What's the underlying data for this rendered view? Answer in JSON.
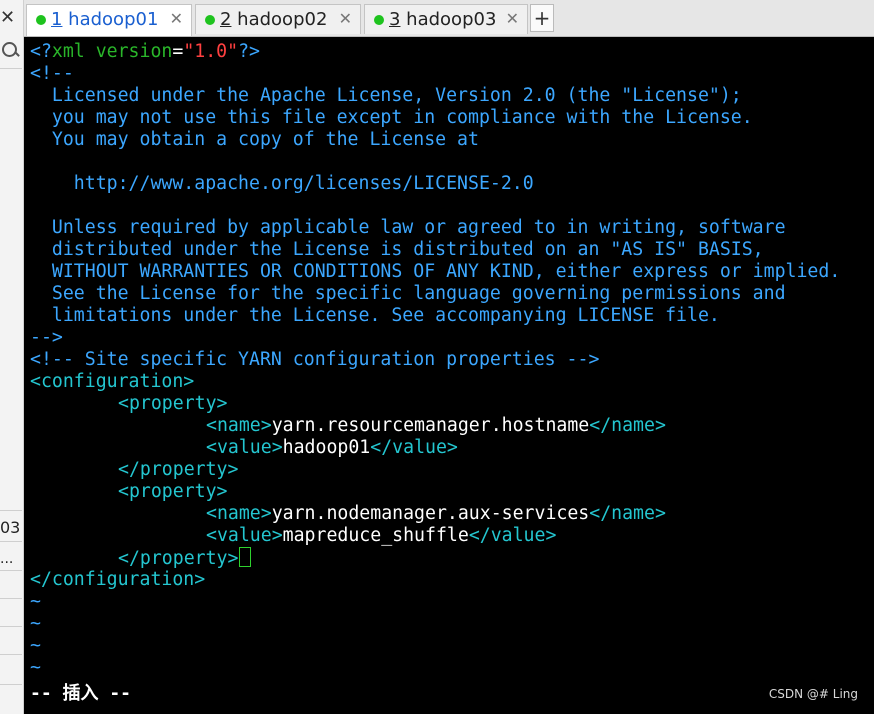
{
  "sidebar": {
    "close_glyph": "✕",
    "number_text": "03",
    "dots_text": "..."
  },
  "tabs": [
    {
      "index": "1",
      "label": " hadoop01",
      "active": true
    },
    {
      "index": "2",
      "label": " hadoop02",
      "active": false
    },
    {
      "index": "3",
      "label": " hadoop03",
      "active": false
    }
  ],
  "tab_close_glyph": "✕",
  "add_tab_glyph": "+",
  "colors": {
    "comment": "#3ca7ff",
    "tag": "#24c6d0",
    "text": "#ffffff",
    "string": "#ff4040",
    "cursor": "#2ed12e",
    "status_dot": "#1ec31e"
  },
  "editor": {
    "xml_decl": {
      "open": "<?",
      "name": "xml version",
      "eq": "=",
      "value": "\"1.0\"",
      "close": "?>"
    },
    "comment_open": "<!--",
    "license_lines": [
      "  Licensed under the Apache License, Version 2.0 (the \"License\");",
      "  you may not use this file except in compliance with the License.",
      "  You may obtain a copy of the License at",
      "",
      "    http://www.apache.org/licenses/LICENSE-2.0",
      "",
      "  Unless required by applicable law or agreed to in writing, software",
      "  distributed under the License is distributed on an \"AS IS\" BASIS,",
      "  WITHOUT WARRANTIES OR CONDITIONS OF ANY KIND, either express or implied.",
      "  See the License for the specific language governing permissions and",
      "  limitations under the License. See accompanying LICENSE file."
    ],
    "comment_close": "-->",
    "site_comment": "<!-- Site specific YARN configuration properties -->",
    "config_open": "<configuration>",
    "property_open": "<property>",
    "property_close": "</property>",
    "name_open": "<name>",
    "name_close": "</name>",
    "value_open": "<value>",
    "value_close": "</value>",
    "properties": [
      {
        "name": "yarn.resourcemanager.hostname",
        "value": "hadoop01"
      },
      {
        "name": "yarn.nodemanager.aux-services",
        "value": "mapreduce_shuffle"
      }
    ],
    "config_close": "</configuration>",
    "tilde": "~",
    "status": "-- 插入 --"
  },
  "watermark": "CSDN @#  Ling"
}
